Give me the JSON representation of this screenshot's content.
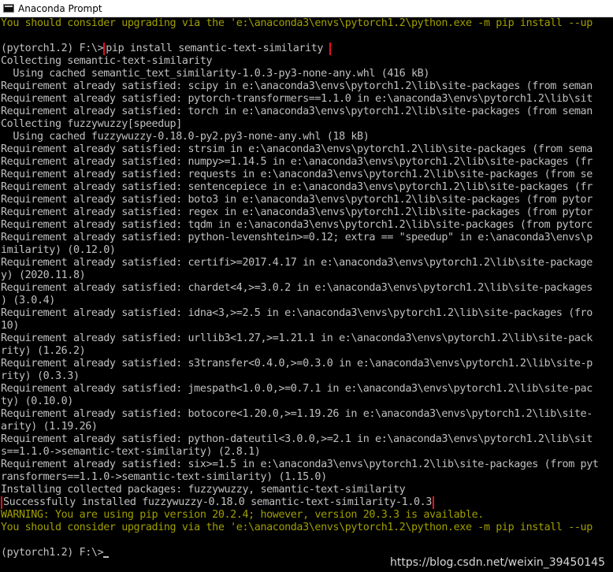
{
  "window": {
    "title": "Anaconda Prompt"
  },
  "terminal": {
    "line_01": "You should consider upgrading via the 'e:\\anaconda3\\envs\\pytorch1.2\\python.exe -m pip install --up",
    "line_02": "",
    "prompt_1": "(pytorch1.2) F:\\>",
    "command_1": "pip install semantic-text-similarity",
    "line_04": "Collecting semantic-text-similarity",
    "line_05": "  Using cached semantic_text_similarity-1.0.3-py3-none-any.whl (416 kB)",
    "line_06": "Requirement already satisfied: scipy in e:\\anaconda3\\envs\\pytorch1.2\\lib\\site-packages (from seman",
    "line_07": "Requirement already satisfied: pytorch-transformers==1.1.0 in e:\\anaconda3\\envs\\pytorch1.2\\lib\\sit",
    "line_08": "Requirement already satisfied: torch in e:\\anaconda3\\envs\\pytorch1.2\\lib\\site-packages (from seman",
    "line_09": "Collecting fuzzywuzzy[speedup]",
    "line_10": "  Using cached fuzzywuzzy-0.18.0-py2.py3-none-any.whl (18 kB)",
    "line_11": "Requirement already satisfied: strsim in e:\\anaconda3\\envs\\pytorch1.2\\lib\\site-packages (from sema",
    "line_12": "Requirement already satisfied: numpy>=1.14.5 in e:\\anaconda3\\envs\\pytorch1.2\\lib\\site-packages (fr",
    "line_13": "Requirement already satisfied: requests in e:\\anaconda3\\envs\\pytorch1.2\\lib\\site-packages (from se",
    "line_14": "Requirement already satisfied: sentencepiece in e:\\anaconda3\\envs\\pytorch1.2\\lib\\site-packages (fr",
    "line_15": "Requirement already satisfied: boto3 in e:\\anaconda3\\envs\\pytorch1.2\\lib\\site-packages (from pytor",
    "line_16": "Requirement already satisfied: regex in e:\\anaconda3\\envs\\pytorch1.2\\lib\\site-packages (from pytor",
    "line_17": "Requirement already satisfied: tqdm in e:\\anaconda3\\envs\\pytorch1.2\\lib\\site-packages (from pytorc",
    "line_18": "Requirement already satisfied: python-levenshtein>=0.12; extra == \"speedup\" in e:\\anaconda3\\envs\\p",
    "line_19": "imilarity) (0.12.0)",
    "line_20": "Requirement already satisfied: certifi>=2017.4.17 in e:\\anaconda3\\envs\\pytorch1.2\\lib\\site-package",
    "line_21": "y) (2020.11.8)",
    "line_22": "Requirement already satisfied: chardet<4,>=3.0.2 in e:\\anaconda3\\envs\\pytorch1.2\\lib\\site-packages",
    "line_23": ") (3.0.4)",
    "line_24": "Requirement already satisfied: idna<3,>=2.5 in e:\\anaconda3\\envs\\pytorch1.2\\lib\\site-packages (fro",
    "line_25": "10)",
    "line_26": "Requirement already satisfied: urllib3<1.27,>=1.21.1 in e:\\anaconda3\\envs\\pytorch1.2\\lib\\site-pack",
    "line_27": "rity) (1.26.2)",
    "line_28": "Requirement already satisfied: s3transfer<0.4.0,>=0.3.0 in e:\\anaconda3\\envs\\pytorch1.2\\lib\\site-p",
    "line_29": "rity) (0.3.3)",
    "line_30": "Requirement already satisfied: jmespath<1.0.0,>=0.7.1 in e:\\anaconda3\\envs\\pytorch1.2\\lib\\site-pac",
    "line_31": "ty) (0.10.0)",
    "line_32": "Requirement already satisfied: botocore<1.20.0,>=1.19.26 in e:\\anaconda3\\envs\\pytorch1.2\\lib\\site-",
    "line_33": "arity) (1.19.26)",
    "line_34": "Requirement already satisfied: python-dateutil<3.0.0,>=2.1 in e:\\anaconda3\\envs\\pytorch1.2\\lib\\sit",
    "line_35": "s==1.1.0->semantic-text-similarity) (2.8.1)",
    "line_36": "Requirement already satisfied: six>=1.5 in e:\\anaconda3\\envs\\pytorch1.2\\lib\\site-packages (from pyt",
    "line_37": "ransformers==1.1.0->semantic-text-similarity) (1.15.0)",
    "line_38": "Installing collected packages: fuzzywuzzy, semantic-text-similarity",
    "line_39": "Successfully installed fuzzywuzzy-0.18.0 semantic-text-similarity-1.0.3",
    "line_40": "WARNING: You are using pip version 20.2.4; however, version 20.3.3 is available.",
    "line_41": "You should consider upgrading via the 'e:\\anaconda3\\envs\\pytorch1.2\\python.exe -m pip install --up",
    "line_42": "",
    "prompt_2": "(pytorch1.2) F:\\>"
  },
  "watermark": "https://blog.csdn.net/weixin_39450145",
  "colors": {
    "background": "#000000",
    "text": "#c0c0c0",
    "warning": "#a19f00",
    "highlight_box": "#e81123"
  }
}
